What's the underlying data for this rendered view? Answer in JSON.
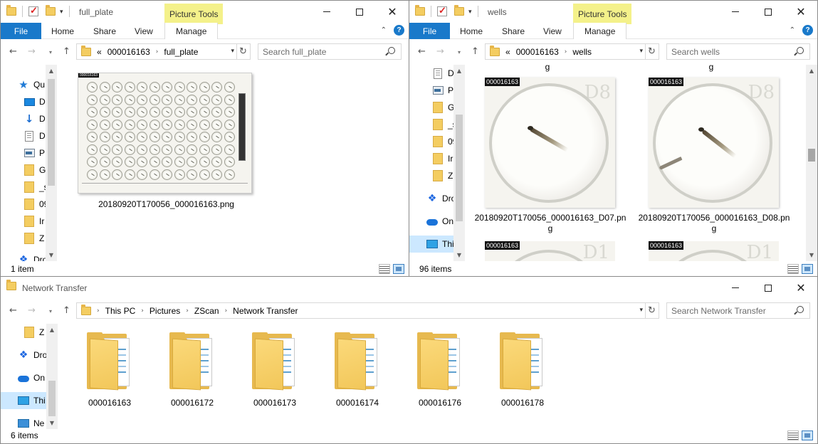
{
  "windows": {
    "full_plate": {
      "title": "full_plate",
      "context_tab": "Picture Tools",
      "ribbon": {
        "file": "File",
        "home": "Home",
        "share": "Share",
        "view": "View",
        "manage": "Manage"
      },
      "address": {
        "overflow": "«",
        "crumbs": [
          "000016163",
          "full_plate"
        ]
      },
      "search_placeholder": "Search full_plate",
      "nav_items": [
        "Qu",
        "D",
        "D",
        "D",
        "P",
        "G",
        "_s",
        "09",
        "Ir",
        "Z",
        "Dro"
      ],
      "files": [
        {
          "name": "20180920T170056_000016163.png",
          "thumb_label": "000016163"
        }
      ],
      "status": "1 item"
    },
    "wells": {
      "title": "wells",
      "context_tab": "Picture Tools",
      "ribbon": {
        "file": "File",
        "home": "Home",
        "share": "Share",
        "view": "View",
        "manage": "Manage"
      },
      "address": {
        "overflow": "«",
        "crumbs": [
          "000016163",
          "wells"
        ]
      },
      "search_placeholder": "Search wells",
      "nav_items": [
        "D",
        "P",
        "G",
        "_s",
        "09",
        "Ir",
        "Z",
        "Dro",
        "On",
        "Thi"
      ],
      "top_captions": [
        "g",
        "g"
      ],
      "files": [
        {
          "name_line1": "20180920T170056_000016163_D07.pn",
          "name_line2": "g",
          "thumb_label": "000016163",
          "ghost": "D8"
        },
        {
          "name_line1": "20180920T170056_000016163_D08.pn",
          "name_line2": "g",
          "thumb_label": "000016163",
          "ghost": "D8"
        }
      ],
      "partial_labels": [
        "000016163",
        "000016163"
      ],
      "partial_ghosts": [
        "D1",
        "D1"
      ],
      "status": "96 items"
    },
    "network": {
      "title": "Network Transfer",
      "address": {
        "crumbs": [
          "This PC",
          "Pictures",
          "ZScan",
          "Network Transfer"
        ]
      },
      "search_placeholder": "Search Network Transfer",
      "nav_items": [
        "Z",
        "Dro",
        "On",
        "Thi",
        "Ne"
      ],
      "folders": [
        "000016163",
        "000016172",
        "000016173",
        "000016174",
        "000016176",
        "000016178"
      ],
      "status": "6 items"
    }
  },
  "icons": {
    "back": "←",
    "forward": "→",
    "up": "↑",
    "recent": "⌄",
    "refresh": "↻",
    "addr_dropdown": "▾",
    "breadcrumb_sep": "›",
    "ribbon_collapse": "⌃",
    "help": "?",
    "close": "✕",
    "scroll_up": "▲",
    "scroll_down": "▼",
    "star": "★",
    "download": "↓",
    "dropbox": "❖"
  },
  "colors": {
    "file_tab": "#1979ca",
    "context_tab": "#f4f18a",
    "nav_selected": "#cce8ff",
    "folder": "#f4cd61"
  }
}
